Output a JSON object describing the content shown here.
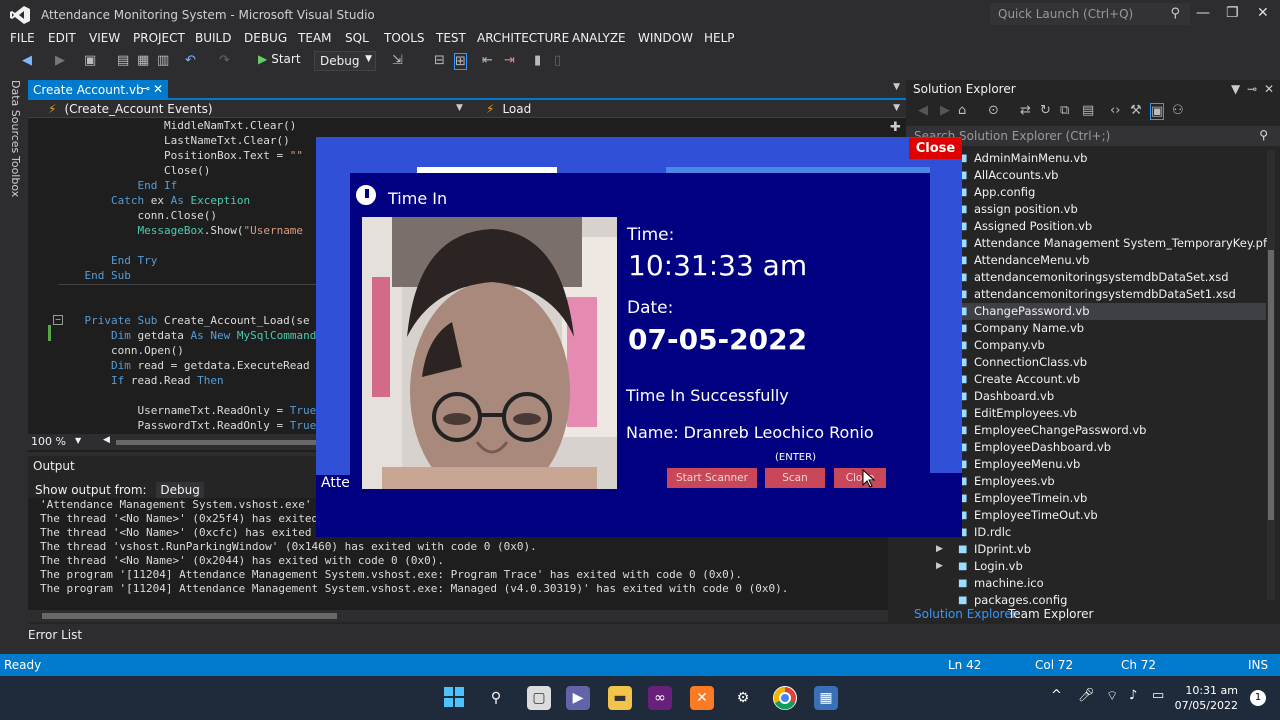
{
  "window": {
    "title": "Attendance Monitoring System - Microsoft Visual Studio",
    "quick_launch": "Quick Launch (Ctrl+Q)"
  },
  "menu": [
    "FILE",
    "EDIT",
    "VIEW",
    "PROJECT",
    "BUILD",
    "DEBUG",
    "TEAM",
    "SQL",
    "TOOLS",
    "TEST",
    "ARCHITECTURE",
    "ANALYZE",
    "WINDOW",
    "HELP"
  ],
  "toolbar": {
    "start_label": "Start",
    "config": "Debug"
  },
  "left_rail": {
    "data_sources": "Data Sources",
    "toolbox": "Toolbox"
  },
  "editor": {
    "tab": "Create Account.vb",
    "nav_left": "(Create_Account Events)",
    "nav_right": "Load",
    "zoom": "100 %"
  },
  "output": {
    "header": "Output",
    "show_from_label": "Show output from:",
    "show_from_value": "Debug",
    "lines": [
      "'Attendance Management System.vshost.exe'",
      "The thread '<No Name>' (0x25f4) has exited",
      "The thread '<No Name>' (0xcfc) has exited",
      "The thread 'vshost.RunParkingWindow' (0x1460) has exited with code 0 (0x0).",
      "The thread '<No Name>' (0x2044) has exited with code 0 (0x0).",
      "The program '[11204] Attendance Management System.vshost.exe: Program Trace' has exited with code 0 (0x0).",
      "The program '[11204] Attendance Management System.vshost.exe: Managed (v4.0.30319)' has exited with code 0 (0x0)."
    ]
  },
  "error_list": "Error List",
  "solution_explorer": {
    "header": "Solution Explorer",
    "search_placeholder": "Search Solution Explorer (Ctrl+;)",
    "items": [
      "AdminMainMenu.vb",
      "AllAccounts.vb",
      "App.config",
      "assign position.vb",
      "Assigned Position.vb",
      "Attendance Management System_TemporaryKey.pfx",
      "AttendanceMenu.vb",
      "attendancemonitoringsystemdbDataSet.xsd",
      "attendancemonitoringsystemdbDataSet1.xsd",
      "ChangePassword.vb",
      "Company Name.vb",
      "Company.vb",
      "ConnectionClass.vb",
      "Create Account.vb",
      "Dashboard.vb",
      "EditEmployees.vb",
      "EmployeeChangePassword.vb",
      "EmployeeDashboard.vb",
      "EmployeeMenu.vb",
      "Employees.vb",
      "EmployeeTimein.vb",
      "EmployeeTimeOut.vb",
      "ID.rdlc",
      "IDprint.vb",
      "Login.vb",
      "machine.ico",
      "packages.config"
    ],
    "tab_solution": "Solution Explorer",
    "tab_team": "Team Explorer"
  },
  "statusbar": {
    "ready": "Ready",
    "ln": "Ln 42",
    "col": "Col 72",
    "ch": "Ch 72",
    "ins": "INS"
  },
  "taskbar": {
    "time": "10:31 am",
    "date": "07/05/2022",
    "notifications": "1"
  },
  "app": {
    "close_top": "Close",
    "title": "Time In",
    "time_label": "Time:",
    "time_value": "10:31:33 am",
    "date_label": "Date:",
    "date_value": "07-05-2022",
    "status": "Time In Successfully",
    "name": "Name: Dranreb Leochico Ronio",
    "enter_hint": "(ENTER)",
    "start_scanner": "Start Scanner",
    "scan": "Scan",
    "close_btn": "Close",
    "atte": "Atte"
  }
}
